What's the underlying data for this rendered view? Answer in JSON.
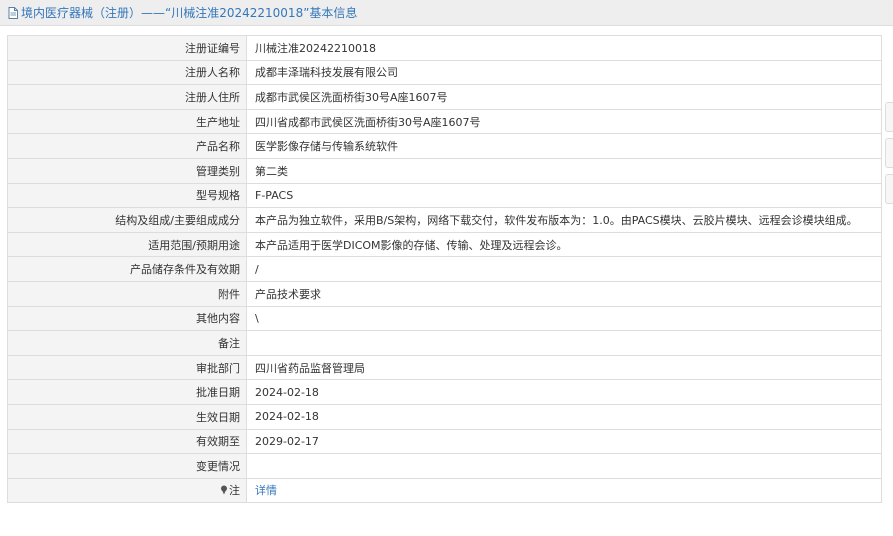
{
  "header": {
    "title": "境内医疗器械（注册）——“川械注准20242210018”基本信息"
  },
  "rows": [
    {
      "label": "注册证编号",
      "value": "川械注准20242210018"
    },
    {
      "label": "注册人名称",
      "value": "成都丰泽瑞科技发展有限公司"
    },
    {
      "label": "注册人住所",
      "value": "成都市武侯区洗面桥街30号A座1607号"
    },
    {
      "label": "生产地址",
      "value": "四川省成都市武侯区洗面桥街30号A座1607号"
    },
    {
      "label": "产品名称",
      "value": "医学影像存储与传输系统软件"
    },
    {
      "label": "管理类别",
      "value": "第二类"
    },
    {
      "label": "型号规格",
      "value": "F-PACS"
    },
    {
      "label": "结构及组成/主要组成成分",
      "value": "本产品为独立软件，采用B/S架构，网络下载交付，软件发布版本为：1.0。由PACS模块、云胶片模块、远程会诊模块组成。"
    },
    {
      "label": "适用范围/预期用途",
      "value": "本产品适用于医学DICOM影像的存储、传输、处理及远程会诊。"
    },
    {
      "label": "产品储存条件及有效期",
      "value": "/"
    },
    {
      "label": "附件",
      "value": "产品技术要求"
    },
    {
      "label": "其他内容",
      "value": "\\"
    },
    {
      "label": "备注",
      "value": ""
    },
    {
      "label": "审批部门",
      "value": "四川省药品监督管理局"
    },
    {
      "label": "批准日期",
      "value": "2024-02-18"
    },
    {
      "label": "生效日期",
      "value": "2024-02-18"
    },
    {
      "label": "有效期至",
      "value": "2029-02-17"
    },
    {
      "label": "变更情况",
      "value": ""
    }
  ],
  "note": {
    "label": "注",
    "link_text": "详情"
  },
  "icons": {
    "title_icon": "document-icon",
    "note_icon": "pin-icon"
  },
  "colors": {
    "link": "#3377bb",
    "label_bg": "#f4f4f4",
    "border": "#dddddd"
  }
}
